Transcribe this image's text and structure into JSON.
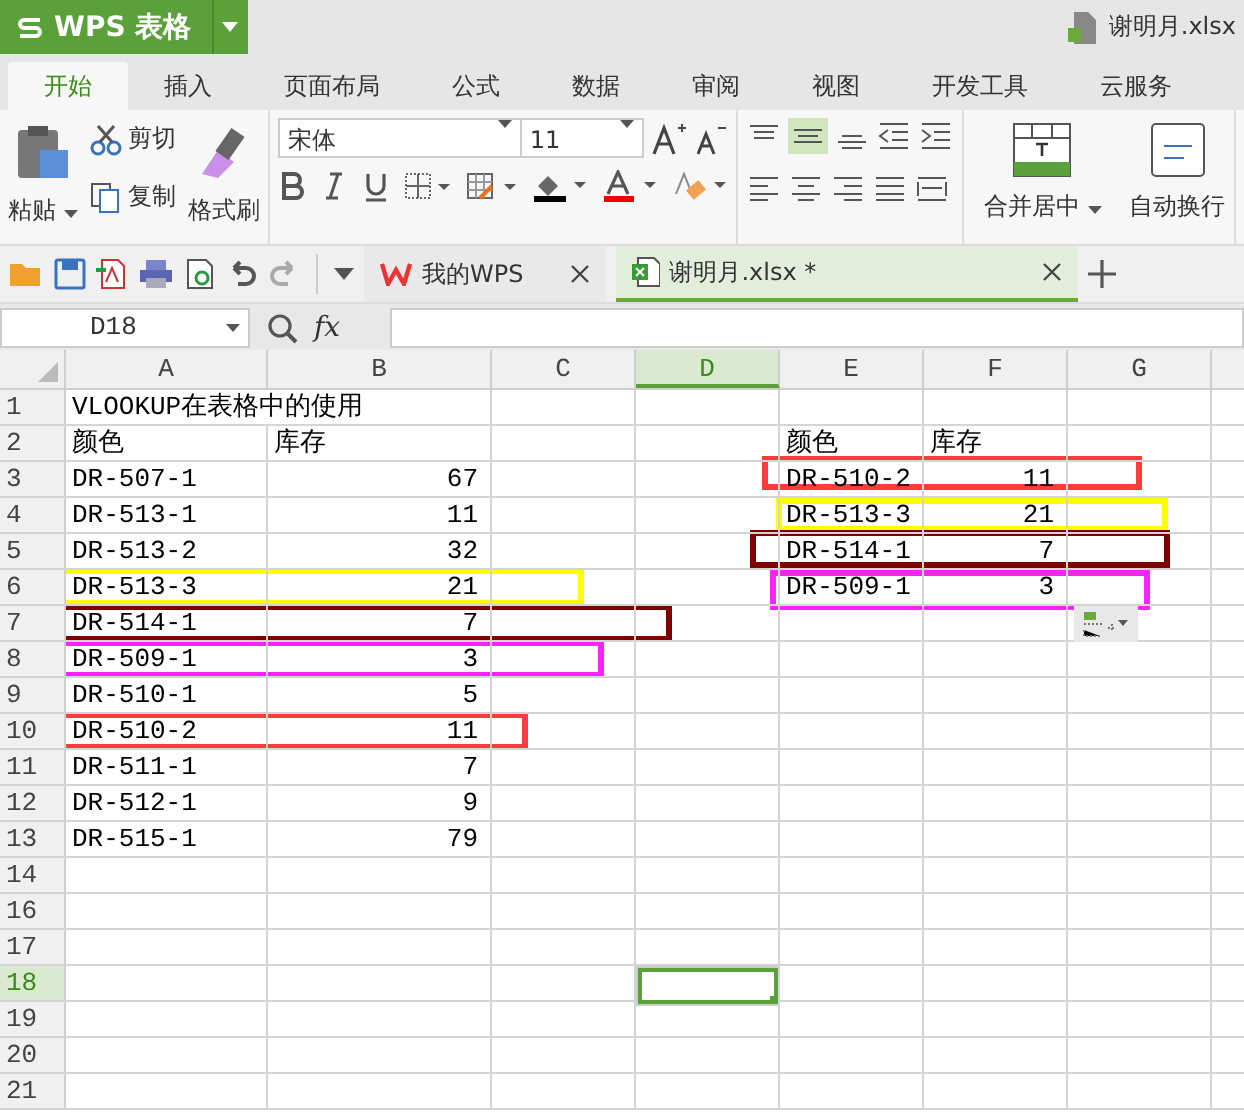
{
  "app": {
    "title": "WPS 表格",
    "file": "谢明月.xlsx"
  },
  "menu_tabs": [
    {
      "label": "开始",
      "selected": true
    },
    {
      "label": "插入",
      "selected": false
    },
    {
      "label": "页面布局",
      "selected": false
    },
    {
      "label": "公式",
      "selected": false
    },
    {
      "label": "数据",
      "selected": false
    },
    {
      "label": "审阅",
      "selected": false
    },
    {
      "label": "视图",
      "selected": false
    },
    {
      "label": "开发工具",
      "selected": false
    },
    {
      "label": "云服务",
      "selected": false
    }
  ],
  "ribbon": {
    "paste": "粘贴",
    "cut": "剪切",
    "copy": "复制",
    "format_painter": "格式刷",
    "font": "宋体",
    "font_size": "11",
    "merge": "合并居中",
    "wrap": "自动换行"
  },
  "doc_tabs": [
    {
      "label": "我的WPS",
      "kind": "home",
      "selected": false
    },
    {
      "label": "谢明月.xlsx *",
      "kind": "sheet",
      "selected": true
    }
  ],
  "formula_bar": {
    "cell_ref": "D18",
    "fx": "fx"
  },
  "columns": [
    {
      "label": "A",
      "selected": false
    },
    {
      "label": "B",
      "selected": false
    },
    {
      "label": "C",
      "selected": false
    },
    {
      "label": "D",
      "selected": true
    },
    {
      "label": "E",
      "selected": false
    },
    {
      "label": "F",
      "selected": false
    },
    {
      "label": "G",
      "selected": false
    }
  ],
  "rows": [
    {
      "number": "1",
      "selected": false,
      "title": "VLOOKUP在表格中的使用"
    },
    {
      "number": "2",
      "selected": false,
      "A": "颜色",
      "B": "库存",
      "E": "颜色",
      "F": "库存"
    },
    {
      "number": "3",
      "selected": false,
      "A": "DR-507-1",
      "B": "67",
      "E": "DR-510-2",
      "F": "11"
    },
    {
      "number": "4",
      "selected": false,
      "A": "DR-513-1",
      "B": "11",
      "E": "DR-513-3",
      "F": "21"
    },
    {
      "number": "5",
      "selected": false,
      "A": "DR-513-2",
      "B": "32",
      "E": "DR-514-1",
      "F": "7"
    },
    {
      "number": "6",
      "selected": false,
      "A": "DR-513-3",
      "B": "21",
      "E": "DR-509-1",
      "F": "3"
    },
    {
      "number": "7",
      "selected": false,
      "A": "DR-514-1",
      "B": "7"
    },
    {
      "number": "8",
      "selected": false,
      "A": "DR-509-1",
      "B": "3"
    },
    {
      "number": "9",
      "selected": false,
      "A": "DR-510-1",
      "B": "5"
    },
    {
      "number": "10",
      "selected": false,
      "A": "DR-510-2",
      "B": "11"
    },
    {
      "number": "11",
      "selected": false,
      "A": "DR-511-1",
      "B": "7"
    },
    {
      "number": "12",
      "selected": false,
      "A": "DR-512-1",
      "B": "9"
    },
    {
      "number": "13",
      "selected": false,
      "A": "DR-515-1",
      "B": "79"
    },
    {
      "number": "14",
      "selected": false
    },
    {
      "number": "16",
      "selected": false
    },
    {
      "number": "17",
      "selected": false
    },
    {
      "number": "18",
      "selected": true
    },
    {
      "number": "19",
      "selected": false
    },
    {
      "number": "20",
      "selected": false
    },
    {
      "number": "21",
      "selected": false
    }
  ],
  "annotation_boxes": [
    {
      "color": "#ffff00"
    },
    {
      "color": "#800000"
    },
    {
      "color": "#ff22ff"
    },
    {
      "color": "#ff3b3b"
    },
    {
      "color": "#ff3b3b"
    },
    {
      "color": "#ffff00"
    },
    {
      "color": "#800000"
    },
    {
      "color": "#ff22ff"
    }
  ]
}
